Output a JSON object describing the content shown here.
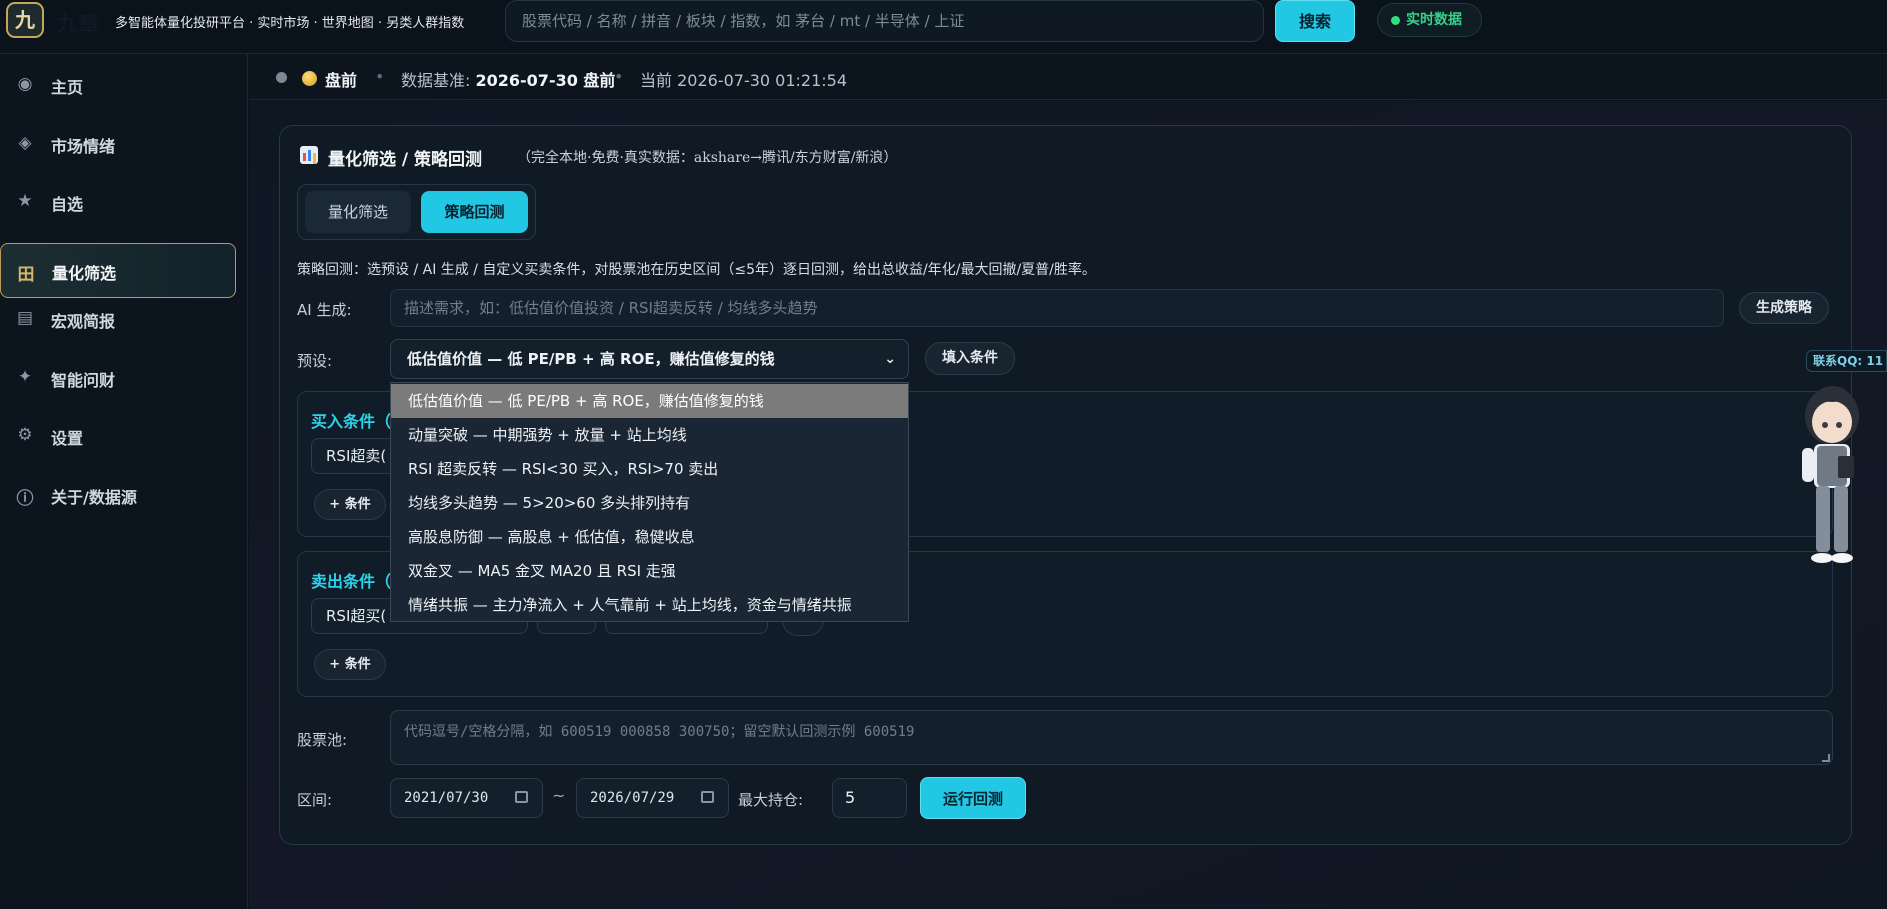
{
  "header": {
    "logo_char": "九",
    "logo_text": "九章",
    "tagline": "多智能体量化投研平台 · 实时市场 · 世界地图 · 另类人群指数",
    "search_placeholder": "股票代码 / 名称 / 拼音 / 板块 / 指数，如 茅台 / mt / 半导体 / 上证",
    "search_button": "搜索",
    "live_badge": "实时数据"
  },
  "sidebar": {
    "items": [
      {
        "label": "主页",
        "icon": "◉"
      },
      {
        "label": "市场情绪",
        "icon": "◈"
      },
      {
        "label": "自选",
        "icon": "★"
      },
      {
        "label": "量化筛选",
        "icon": "田"
      },
      {
        "label": "宏观简报",
        "icon": "▤"
      },
      {
        "label": "智能问财",
        "icon": "✦"
      },
      {
        "label": "设置",
        "icon": "⚙"
      },
      {
        "label": "关于/数据源",
        "icon": "ⓘ"
      }
    ],
    "active_index": 3
  },
  "status": {
    "phase": "盘前",
    "base_label": "数据基准:",
    "base_value": "2026-07-30 盘前",
    "now": "当前 2026-07-30 01:21:54",
    "sep": "•"
  },
  "card": {
    "title": "量化筛选 / 策略回测",
    "subtitle": "（完全本地·免费·真实数据：akshare→腾讯/东方财富/新浪）",
    "tabs": [
      "量化筛选",
      "策略回测"
    ],
    "description": "策略回测：选预设 / AI 生成 / 自定义买卖条件，对股票池在历史区间（≤5年）逐日回测，给出总收益/年化/最大回撤/夏普/胜率。",
    "ai_label": "AI 生成:",
    "ai_placeholder": "描述需求，如：低估值价值投资 / RSI超卖反转 / 均线多头趋势",
    "gen_button": "生成策略",
    "preset_label": "预设:",
    "preset_selected": "低估值价值 — 低 PE/PB + 高 ROE，赚估值修复的钱",
    "fill_button": "填入条件",
    "preset_options": [
      "低估值价值 — 低 PE/PB + 高 ROE，赚估值修复的钱",
      "动量突破 — 中期强势 + 放量 + 站上均线",
      "RSI 超卖反转 — RSI<30 买入，RSI>70 卖出",
      "均线多头趋势 — 5>20>60 多头排列持有",
      "高股息防御 — 高股息 + 低估值，稳健收息",
      "双金叉 — MA5 金叉 MA20 且 RSI 走强",
      "情绪共振 — 主力净流入 + 人气靠前 + 站上均线，资金与情绪共振"
    ],
    "buy": {
      "title": "买入条件（",
      "chip": "RSI超卖(",
      "add_button": "+ 条件"
    },
    "sell": {
      "title": "卖出条件（",
      "chip": "RSI超买(",
      "add_button": "+ 条件"
    },
    "pool_label": "股票池:",
    "pool_placeholder": "代码逗号/空格分隔，如 600519 000858 300750；留空默认回测示例 600519",
    "range_label": "区间:",
    "start_date": "2021/07/30",
    "end_date": "2026/07/29",
    "tilde": "~",
    "max_hold_label": "最大持仓:",
    "max_hold_value": "5",
    "run_button": "运行回测"
  },
  "contact": {
    "qq_label": "联系QQ: 11"
  }
}
